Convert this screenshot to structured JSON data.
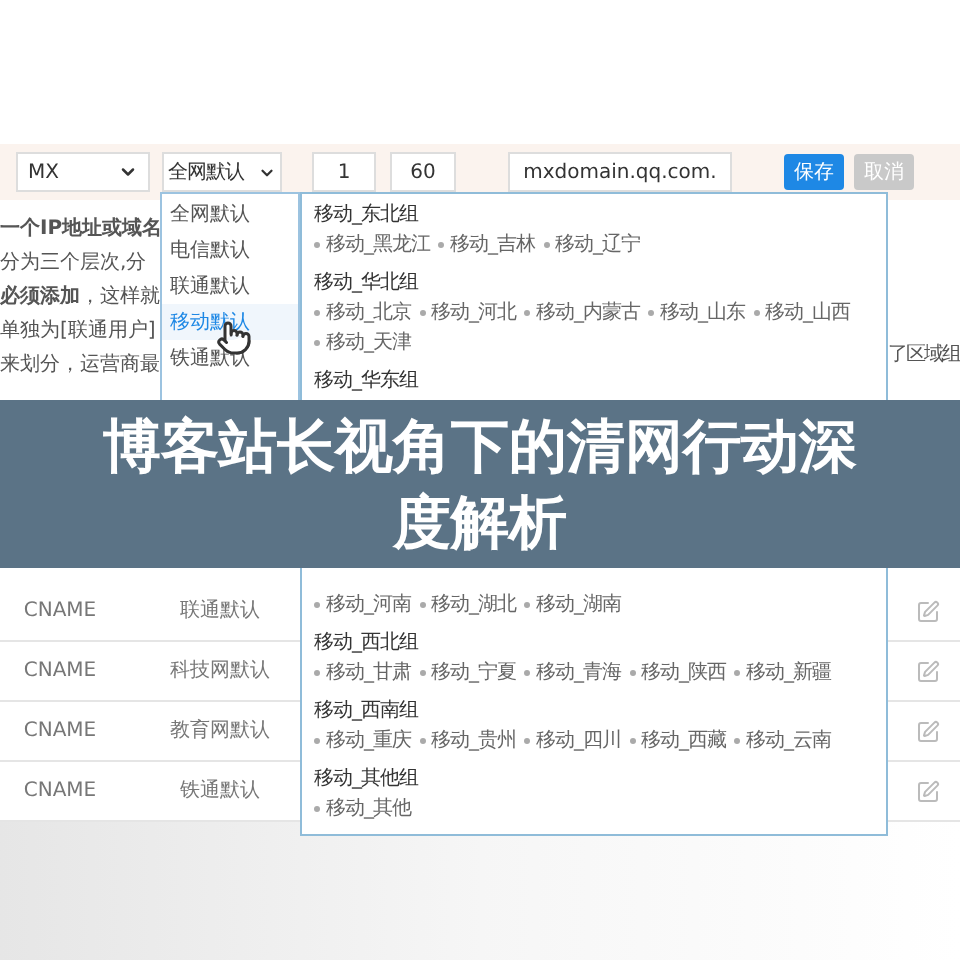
{
  "toolbar": {
    "record_type": "MX",
    "line": "全网默认",
    "priority": "1",
    "ttl": "60",
    "value": "mxdomain.qq.com.",
    "buttons": [
      {
        "label": "保存",
        "kind": "primary"
      },
      {
        "label": "取消",
        "kind": "disabled"
      }
    ]
  },
  "help_text": [
    {
      "text": "一个IP地址或域名",
      "bold": true
    },
    {
      "text": "分为三个层次,分",
      "bold": false
    },
    {
      "text": "**必须添加**，这样就",
      "bold": false
    },
    {
      "text": "单独为[联通用户]",
      "bold": false
    },
    {
      "text": "来划分，运营商最",
      "bold": false
    }
  ],
  "side_note": [
    "了区域组"
  ],
  "line_menu": {
    "items": [
      {
        "label": "全网默认",
        "selected": false
      },
      {
        "label": "电信默认",
        "selected": false
      },
      {
        "label": "联通默认",
        "selected": false
      },
      {
        "label": "移动默认",
        "selected": true
      },
      {
        "label": "铁通默认",
        "selected": false
      }
    ]
  },
  "region_panel": {
    "top_groups": [
      {
        "name": "移动_东北组",
        "items": [
          "移动_黑龙江",
          "移动_吉林",
          "移动_辽宁"
        ]
      },
      {
        "name": "移动_华北组",
        "items": [
          "移动_北京",
          "移动_河北",
          "移动_内蒙古",
          "移动_山东",
          "移动_山西",
          "移动_天津"
        ]
      },
      {
        "name": "移动_华东组"
      }
    ],
    "bottom_groups": [
      {
        "items": [
          "移动_河南",
          "移动_湖北",
          "移动_湖南"
        ]
      },
      {
        "name": "移动_西北组",
        "items": [
          "移动_甘肃",
          "移动_宁夏",
          "移动_青海",
          "移动_陕西",
          "移动_新疆"
        ]
      },
      {
        "name": "移动_西南组",
        "items": [
          "移动_重庆",
          "移动_贵州",
          "移动_四川",
          "移动_西藏",
          "移动_云南"
        ]
      },
      {
        "name": "移动_其他组",
        "items": [
          "移动_其他"
        ]
      }
    ]
  },
  "banner": {
    "title": "博客站长视角下的清网行动深度解析"
  },
  "records": [
    {
      "type": "CNAME",
      "line": "联通默认"
    },
    {
      "type": "CNAME",
      "line": "科技网默认"
    },
    {
      "type": "CNAME",
      "line": "教育网默认"
    },
    {
      "type": "CNAME",
      "line": "铁通默认"
    }
  ]
}
